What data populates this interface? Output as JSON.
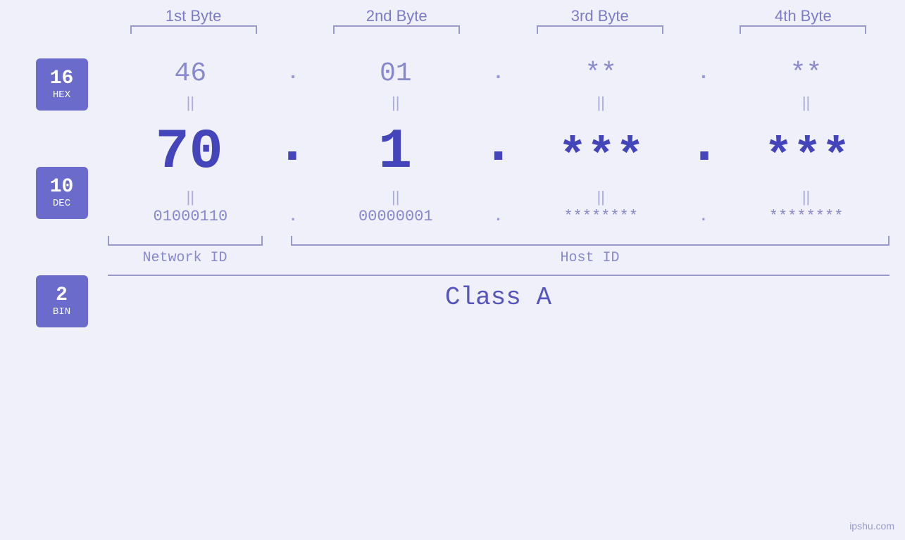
{
  "page": {
    "background": "#f0f0fa",
    "watermark": "ipshu.com"
  },
  "headers": {
    "byte1": "1st Byte",
    "byte2": "2nd Byte",
    "byte3": "3rd Byte",
    "byte4": "4th Byte"
  },
  "badges": {
    "hex": {
      "number": "16",
      "label": "HEX"
    },
    "dec": {
      "number": "10",
      "label": "DEC"
    },
    "bin": {
      "number": "2",
      "label": "BIN"
    }
  },
  "hex_row": {
    "b1": "46",
    "b2": "01",
    "b3": "**",
    "b4": "**",
    "dots": [
      ".",
      ".",
      ".",
      "."
    ]
  },
  "dec_row": {
    "b1": "70",
    "b2": "1",
    "b3": "***",
    "b4": "***",
    "dots": [
      ".",
      ".",
      ".",
      "."
    ]
  },
  "bin_row": {
    "b1": "01000110",
    "b2": "00000001",
    "b3": "********",
    "b4": "********",
    "dots": [
      ".",
      ".",
      ".",
      "."
    ]
  },
  "labels": {
    "network_id": "Network ID",
    "host_id": "Host ID",
    "class": "Class A"
  },
  "equals": "||"
}
